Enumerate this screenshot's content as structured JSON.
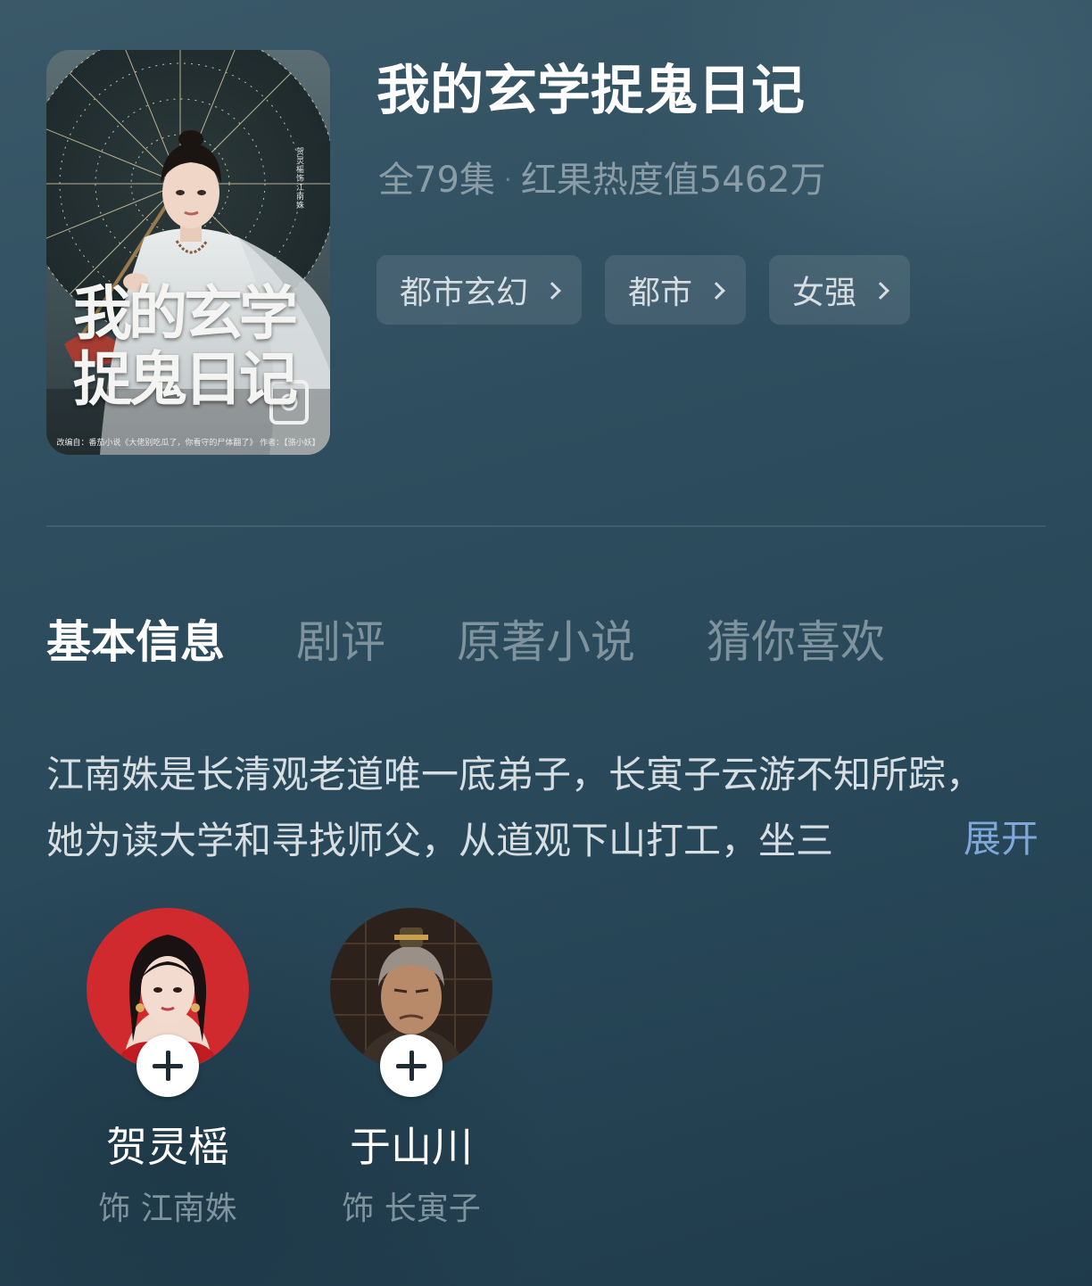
{
  "show": {
    "title": "我的玄学捉鬼日记",
    "episodes": "全79集",
    "separator": "·",
    "popularity": "红果热度值5462万",
    "poster_title": "我的玄学\n捉鬼日记",
    "poster_credit": "改编自：番茄小说《大佬别吃瓜了，你看守的尸体翻了》 作者：【骆小妖】"
  },
  "tags": [
    {
      "label": "都市玄幻"
    },
    {
      "label": "都市"
    },
    {
      "label": "女强"
    }
  ],
  "tabs": [
    {
      "label": "基本信息",
      "active": true
    },
    {
      "label": "剧评",
      "active": false
    },
    {
      "label": "原著小说",
      "active": false
    },
    {
      "label": "猜你喜欢",
      "active": false
    }
  ],
  "synopsis": {
    "lines": [
      "江南姝是长清观老道唯一底弟子，长寅子云游不知所踪，",
      "她为读大学和寻找师父，从道观下山打工，坐三"
    ],
    "expand_label": "展开"
  },
  "cast": [
    {
      "name": "贺灵榣",
      "role": "饰 江南姝",
      "avatar_bg": "#d02a2e"
    },
    {
      "name": "于山川",
      "role": "饰 长寅子",
      "avatar_bg": "#3a2a20"
    }
  ],
  "colors": {
    "accent_link": "#7fa8d8",
    "muted_text": "#8a9da6",
    "background": "#2e4e5f"
  }
}
